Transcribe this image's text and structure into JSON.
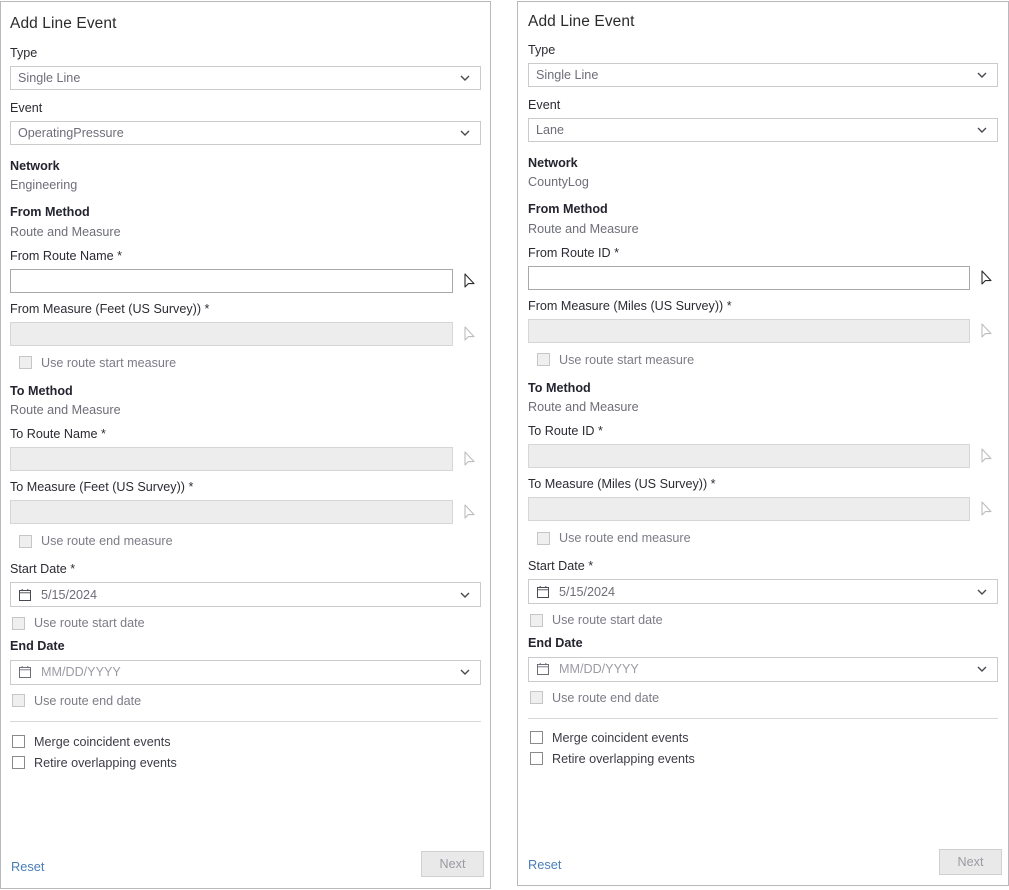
{
  "panels": [
    {
      "title": "Add Line Event",
      "type": {
        "label": "Type",
        "value": "Single Line"
      },
      "event": {
        "label": "Event",
        "value": "OperatingPressure"
      },
      "network": {
        "label": "Network",
        "value": "Engineering"
      },
      "from_method": {
        "label": "From Method",
        "value": "Route and Measure"
      },
      "from_route": {
        "label": "From Route Name *",
        "value": "",
        "enabled": true
      },
      "from_measure": {
        "label": "From Measure (Feet (US Survey)) *",
        "value": "",
        "enabled": false
      },
      "use_route_start_measure": {
        "label": "Use route start measure",
        "checked": false,
        "enabled": false
      },
      "to_method": {
        "label": "To Method",
        "value": "Route and Measure"
      },
      "to_route": {
        "label": "To Route Name *",
        "value": "",
        "enabled": false
      },
      "to_measure": {
        "label": "To Measure (Feet (US Survey)) *",
        "value": "",
        "enabled": false
      },
      "use_route_end_measure": {
        "label": "Use route end measure",
        "checked": false,
        "enabled": false
      },
      "start_date": {
        "label": "Start Date *",
        "value": "5/15/2024",
        "placeholder": "MM/DD/YYYY",
        "is_placeholder": false
      },
      "use_route_start_date": {
        "label": "Use route start date",
        "checked": false,
        "enabled": false
      },
      "end_date": {
        "label": "End Date",
        "value": "MM/DD/YYYY",
        "placeholder": "MM/DD/YYYY",
        "is_placeholder": true
      },
      "use_route_end_date": {
        "label": "Use route end date",
        "checked": false,
        "enabled": false
      },
      "merge_coincident": {
        "label": "Merge coincident events",
        "checked": false,
        "enabled": true
      },
      "retire_overlapping": {
        "label": "Retire overlapping events",
        "checked": false,
        "enabled": true
      },
      "reset_label": "Reset",
      "next_label": "Next"
    },
    {
      "title": "Add Line Event",
      "type": {
        "label": "Type",
        "value": "Single Line"
      },
      "event": {
        "label": "Event",
        "value": "Lane"
      },
      "network": {
        "label": "Network",
        "value": "CountyLog"
      },
      "from_method": {
        "label": "From Method",
        "value": "Route and Measure"
      },
      "from_route": {
        "label": "From Route ID *",
        "value": "",
        "enabled": true
      },
      "from_measure": {
        "label": "From Measure (Miles (US Survey)) *",
        "value": "",
        "enabled": false
      },
      "use_route_start_measure": {
        "label": "Use route start measure",
        "checked": false,
        "enabled": false
      },
      "to_method": {
        "label": "To Method",
        "value": "Route and Measure"
      },
      "to_route": {
        "label": "To Route ID *",
        "value": "",
        "enabled": false
      },
      "to_measure": {
        "label": "To Measure (Miles (US Survey)) *",
        "value": "",
        "enabled": false
      },
      "use_route_end_measure": {
        "label": "Use route end measure",
        "checked": false,
        "enabled": false
      },
      "start_date": {
        "label": "Start Date *",
        "value": "5/15/2024",
        "placeholder": "MM/DD/YYYY",
        "is_placeholder": false
      },
      "use_route_start_date": {
        "label": "Use route start date",
        "checked": false,
        "enabled": false
      },
      "end_date": {
        "label": "End Date",
        "value": "MM/DD/YYYY",
        "placeholder": "MM/DD/YYYY",
        "is_placeholder": true
      },
      "use_route_end_date": {
        "label": "Use route end date",
        "checked": false,
        "enabled": false
      },
      "merge_coincident": {
        "label": "Merge coincident events",
        "checked": false,
        "enabled": true
      },
      "retire_overlapping": {
        "label": "Retire overlapping events",
        "checked": false,
        "enabled": true
      },
      "reset_label": "Reset",
      "next_label": "Next"
    }
  ],
  "icons": {
    "chevron": "chevron-down-icon",
    "pick": "map-pick-cursor-icon",
    "calendar": "calendar-icon"
  },
  "colors": {
    "link": "#4a7ebb",
    "label": "#2b2b33",
    "value": "#6e6e78",
    "border": "#b9b9bd",
    "disabled_fill": "#ededed"
  }
}
